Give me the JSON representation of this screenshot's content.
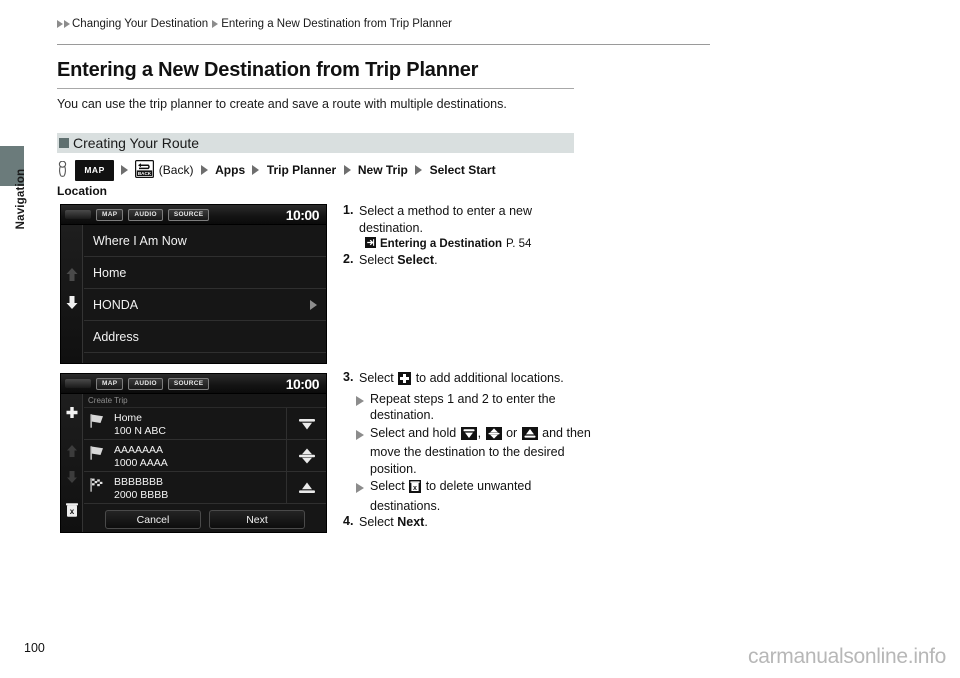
{
  "sidebar": {
    "label": "Navigation"
  },
  "breadcrumb": {
    "item1": "Changing Your Destination",
    "item2": "Entering a New Destination from Trip Planner"
  },
  "page": {
    "title": "Entering a New Destination from Trip Planner",
    "intro": "You can use the trip planner to create and save a route with multiple destinations.",
    "number": "100",
    "watermark": "carmanualsonline.info"
  },
  "section": {
    "title": "Creating Your Route"
  },
  "navpath": {
    "hand_icon": "press-finger-icon",
    "map_button": "MAP",
    "back_icon_label": "BACK",
    "back_text": "(Back)",
    "step_apps": "Apps",
    "step_trip_planner": "Trip Planner",
    "step_new_trip": "New Trip",
    "step_select_start": "Select Start",
    "step_location": "Location"
  },
  "screen1": {
    "topbar": {
      "map": "MAP",
      "audio": "AUDIO",
      "source": "SOURCE",
      "clock": "10:00"
    },
    "rows": [
      {
        "label": "Where I Am Now",
        "has_chevron": false
      },
      {
        "label": "Home",
        "has_chevron": false
      },
      {
        "label": "HONDA",
        "has_chevron": true
      },
      {
        "label": "Address",
        "has_chevron": false
      }
    ],
    "rail": {
      "up_icon": "scroll-up-arrow-icon",
      "down_icon": "scroll-down-arrow-icon"
    }
  },
  "screen2": {
    "topbar": {
      "map": "MAP",
      "audio": "AUDIO",
      "source": "SOURCE",
      "clock": "10:00"
    },
    "header": "Create Trip",
    "rail": {
      "add_icon": "plus-icon",
      "up_icon": "scroll-up-arrow-icon",
      "down_icon": "scroll-down-arrow-icon",
      "delete_icon": "trash-delete-icon"
    },
    "rows": [
      {
        "flag_icon": "flag-icon",
        "name": "Home",
        "address": "100 N ABC",
        "move_icon": "move-down-icon"
      },
      {
        "flag_icon": "flag-icon",
        "name": "AAAAAAA",
        "address": "1000 AAAA",
        "move_icon": "move-up-down-icon"
      },
      {
        "flag_icon": "checkered-flag-icon",
        "name": "BBBBBBB",
        "address": "2000 BBBB",
        "move_icon": "move-up-icon"
      }
    ],
    "buttons": {
      "cancel": "Cancel",
      "next": "Next"
    }
  },
  "steps": {
    "s1": {
      "num": "1.",
      "text_a": "Select a method to enter a new destination.",
      "ref_icon": "reference-arrow-icon",
      "ref_title": "Entering a Destination",
      "ref_page": "P. 54"
    },
    "s2": {
      "num": "2.",
      "text_a": "Select ",
      "bold_a": "Select",
      "text_b": "."
    },
    "s3": {
      "num": "3.",
      "text_a": "Select ",
      "icon_a": "plus-icon",
      "text_b": " to add additional locations.",
      "sub1": "Repeat steps 1 and 2 to enter the destination.",
      "sub2_a": "Select and hold ",
      "sub2_icon1": "move-down-icon",
      "sub2_sep1": ", ",
      "sub2_icon2": "move-up-down-icon",
      "sub2_sep2": " or ",
      "sub2_icon3": "move-up-icon",
      "sub2_b": " and then move the destination to the desired position.",
      "sub3_a": "Select ",
      "sub3_icon": "delete-x-icon",
      "sub3_b": " to delete unwanted destinations."
    },
    "s4": {
      "num": "4.",
      "text_a": "Select ",
      "bold_a": "Next",
      "text_b": "."
    }
  },
  "colors": {
    "band": "#d9dfdf",
    "bullet": "#5f6f6f",
    "sidebar_tab": "#6b7b7b",
    "screen_bg": "#161616",
    "watermark": "#b7b7b7"
  }
}
